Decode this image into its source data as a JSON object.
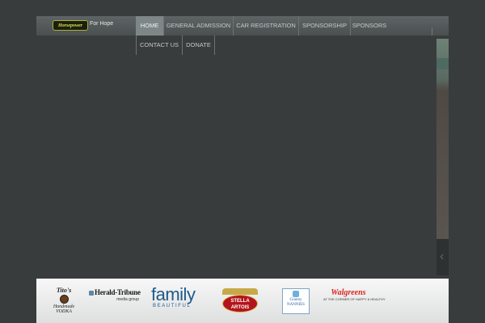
{
  "header": {
    "logo_text": "Horsepower",
    "tagline": "For Hope"
  },
  "nav": {
    "row1": [
      "HOME",
      "GENERAL ADMISSION",
      "CAR REGISTRATION",
      "SPONSORSHIP",
      "SPONSORS"
    ],
    "row2": [
      "CONTACT US",
      "DONATE"
    ],
    "active": "HOME"
  },
  "sponsors": {
    "titos": {
      "line1": "Tito's",
      "line2": "Handmade",
      "line3": "VODKA"
    },
    "herald": {
      "name": "Herald-Tribune",
      "sub": "media group"
    },
    "family": {
      "name": "family",
      "sub": "BEAUTIFUL"
    },
    "stella": {
      "line1": "STELLA",
      "line2": "ARTOIS"
    },
    "granny": {
      "line1": "Granny",
      "line2": "NANNIES"
    },
    "walgreens": {
      "name": "Walgreens",
      "slogan": "AT THE CORNER OF HAPPY & HEALTHY"
    }
  },
  "colors": {
    "page_bg": "#383c3c",
    "nav_bg": "#53595a",
    "nav_active": "#7e8687",
    "logo_accent": "#dbe34a"
  }
}
